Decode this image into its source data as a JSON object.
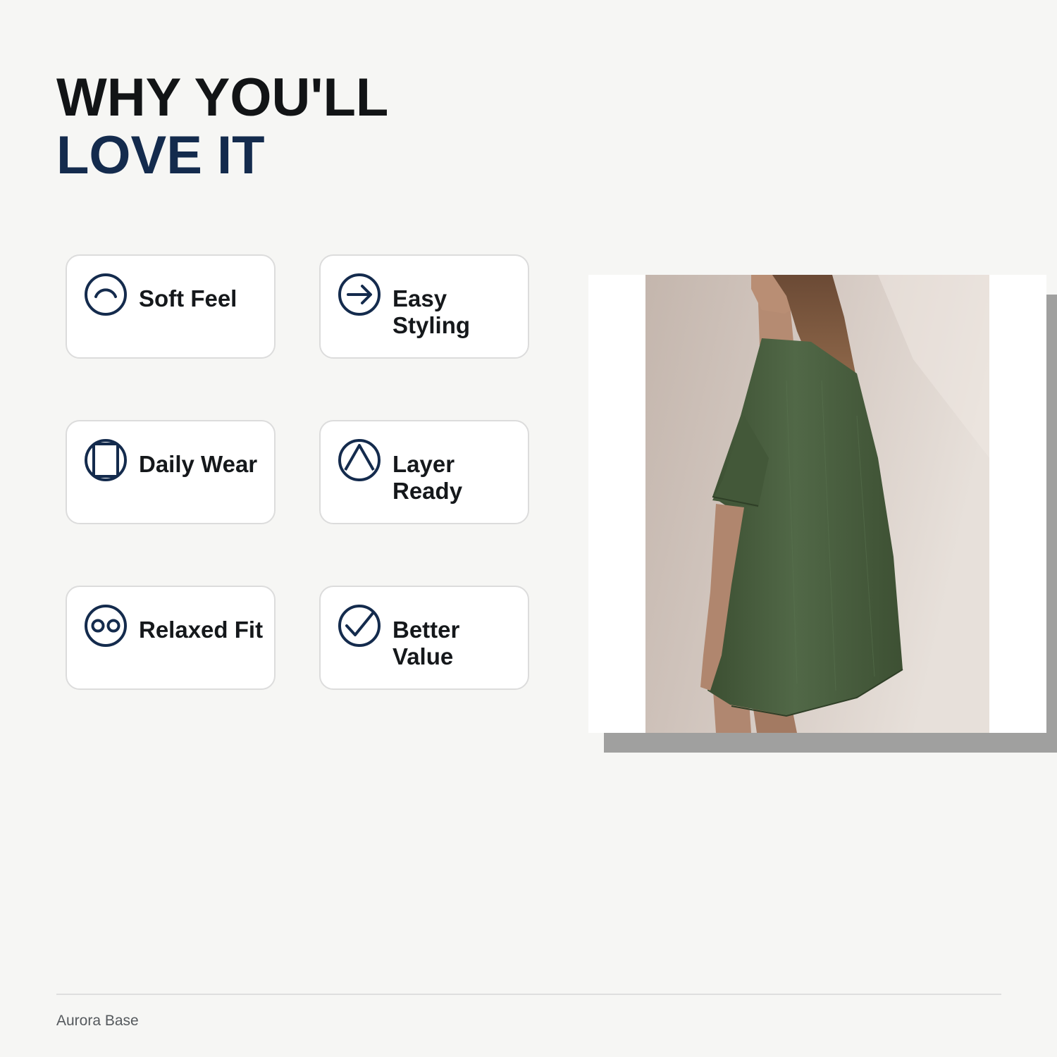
{
  "headline": {
    "line1": "WHY YOU'LL",
    "line2": "LOVE IT"
  },
  "colors": {
    "accent_navy": "#142b4d",
    "text_dark": "#121416",
    "background": "#f6f6f4"
  },
  "features": [
    {
      "label": "Soft Feel",
      "icon": "smile-arc-icon"
    },
    {
      "label": "Easy Styling",
      "icon": "arrow-right-circle-icon"
    },
    {
      "label": "Daily Wear",
      "icon": "square-circle-icon"
    },
    {
      "label": "Layer Ready",
      "icon": "triangle-circle-icon"
    },
    {
      "label": "Relaxed Fit",
      "icon": "double-ring-icon"
    },
    {
      "label": "Better Value",
      "icon": "checkmark-circle-icon"
    }
  ],
  "footer": {
    "brand": "Aurora Base"
  }
}
